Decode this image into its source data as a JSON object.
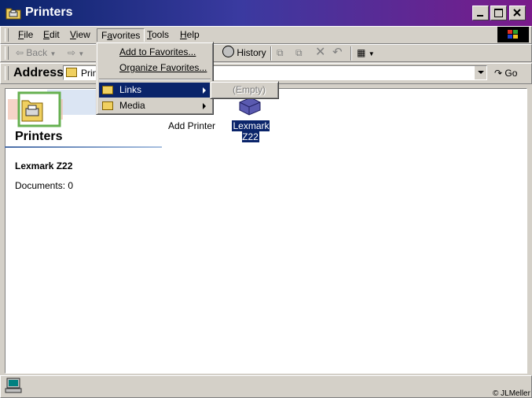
{
  "window": {
    "title": "Printers"
  },
  "menubar": [
    {
      "label": "File",
      "key": "F",
      "rest": "ile"
    },
    {
      "label": "Edit",
      "key": "E",
      "rest": "dit"
    },
    {
      "label": "View",
      "key": "V",
      "rest": "iew"
    },
    {
      "label": "Favorites",
      "key": "a",
      "pre": "F",
      "rest": "vorites"
    },
    {
      "label": "Tools",
      "key": "T",
      "rest": "ools"
    },
    {
      "label": "Help",
      "key": "H",
      "rest": "elp"
    }
  ],
  "toolbar": {
    "back": "Back",
    "history": "History"
  },
  "address": {
    "label": "Address",
    "value": "Printers",
    "go": "Go"
  },
  "favorites_menu": {
    "add": "Add to Favorites...",
    "organize": "Organize Favorites...",
    "links": "Links",
    "media": "Media",
    "links_submenu_empty": "(Empty)"
  },
  "content": {
    "folder_title": "Printers",
    "selected_name": "Lexmark Z22",
    "documents_line": "Documents: 0",
    "icons": [
      {
        "label": "Add Printer"
      },
      {
        "label": "Lexmark Z22"
      }
    ]
  },
  "status": {
    "copyright": "© JLMeller"
  },
  "colors": {
    "title_start": "#0a246a",
    "title_end": "#7a1a8a",
    "highlight": "#0a246a",
    "face": "#d4d0c8"
  }
}
